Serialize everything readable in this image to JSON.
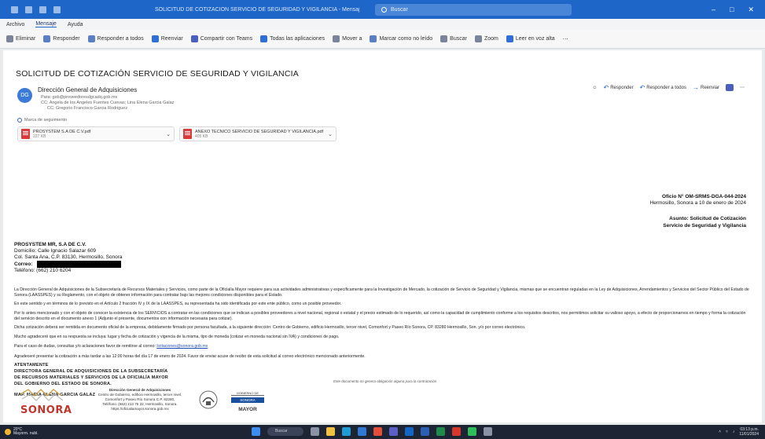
{
  "titlebar": {
    "title": "SOLICITUD DE COTIZACIÓN SERVICIO DE SEGURIDAD Y VIGILANCIA - Mensaje (HTML)",
    "search_placeholder": "Buscar"
  },
  "menu": {
    "tabs": [
      "Archivo",
      "Mensaje",
      "Ayuda"
    ]
  },
  "ribbon": {
    "items": [
      "Eliminar",
      "Responder",
      "Responder a todos",
      "Reenviar",
      "Compartir con Teams",
      "Todas las aplicaciones",
      "Mover a",
      "Marcar como no leído",
      "Buscar",
      "Zoom",
      "Leer en voz alta"
    ]
  },
  "message": {
    "subject": "SOLICITUD DE COTIZACIÓN SERVICIO DE SEGURIDAD Y VIGILANCIA",
    "sender": "Dirección General de Adquisiciones",
    "avatar_initials": "DG",
    "header_lines": [
      "Para: gsb@proveedoresdgcadq.gob.mx",
      "CC: Angela de los Angeles Fuentes Cuevas; Lina Elena Garcia Galaz",
      "CC: Gregorio Francisco Garcia Rodriguez"
    ],
    "flag_text": "Marca de seguimiento",
    "actions": [
      "Responder",
      "Responder a todos",
      "Reenviar"
    ],
    "attachments": [
      {
        "name": "PROSYSTEM S.A DE C.V.pdf",
        "size": "227 KB"
      },
      {
        "name": "ANEXO TECNICO SERVICIO DE SEGURIDAD Y VIGILANCIA.pdf",
        "size": "405 KB"
      }
    ]
  },
  "document": {
    "oficio": "Oficio N° OM-SRMS-DGA-044-2024",
    "place_date": "Hermosillo, Sonora a 10 de enero de 2024",
    "asunto_label": "Asunto: Solicitud de Cotización",
    "asunto_value": "Servicio de Seguridad y Vigilancia",
    "company": "PROSYSTEM MR, S.A DE C.V.",
    "domicilio": "Domicilio: Calle Ignacio Salazar 609",
    "colonia": "Col. Santa Ana, C.P. 83130, Hermosillo, Sonora",
    "correo_label": "Correo:",
    "telefono": "Teléfono: (662) 210 6204",
    "paragraphs": [
      "La Dirección General de Adquisiciones de la Subsecretaría de Recursos Materiales y Servicios, como parte de la Oficialía Mayor requiere para sus actividades administrativas y específicamente para la Investigación de Mercado, la cotización de Servicio de Seguridad y Vigilancia, mismas que se encuentran reguladas en la Ley de Adquisiciones, Arrendamientos y Servicios del Sector Público del Estado de Sonora (LAASSPES) y su Reglamento, con el objeto de obtener información para contratar bajo las mejores condiciones disponibles para el Estado.",
      "En este sentido y en términos de lo previsto en el Artículo 2 fracción IV y IX de la LAASSPES, su representada ha sido identificada por este ente público, como un posible proveedor.",
      "Por lo antes mencionado y con el objeto de conocer la existencia de los SERVICIOS a contratar en las condiciones que se indican a posibles proveedores a nivel nacional, regional o estatal y el precio estimado de lo requerido, así como la capacidad de cumplimiento conforme a los requisitos descritos, nos permitimos solicitar su valioso apoyo, a efecto de proporcionarnos en tiempo y forma la cotización del servicio descrito en el documento anexo 1 (Adjunto el presente, documentos con información necesaria para cotizar).",
      "Dicha cotización deberá ser remitida en documento oficial de la empresa, debidamente firmado por persona facultada, a la siguiente dirección: Centro de Gobierno, edificio Hermosillo, tercer nivel, Comonfort y Paseo Río Sonora, CP. 83280 Hermosillo, Son. y/o por correo electrónico.",
      "Mucho agradeceré que en su respuesta se incluya: lugar y fecha de cotización y vigencia de la misma, tipo de moneda (cotizar en moneda nacional sin IVA) y condiciones de pago.",
      "Para el caso de dudas, consultas y/o aclaraciones favor de remitirse al correo:",
      "Agradeceré presentar la cotización a más tardar a las 12:00 horas del día 17 de enero de 2024. Favor de enviar acuse de recibo de esta solicitud al correo electrónico mencionado anteriormente."
    ],
    "contact_email": "licitaciones@sonora.gob.mx",
    "sign_lines": [
      "ATENTAMENTE",
      "DIRECTORA GENERAL DE ADQUISICIONES DE LA SUBSECRETARÍA",
      "DE RECURSOS MATERIALES Y SERVICIOS DE LA OFICIALÍA MAYOR",
      "DEL GOBIERNO DEL ESTADO DE SONORA."
    ],
    "signer": "MAP. MARIA ELENA GARCIA GALAZ",
    "disclaimer": "Este documento no genera obligación alguna para la contratación",
    "footer_logo_text": "SONORA",
    "footer_lines": [
      "Dirección General de Adquisiciones",
      "Centro de Gobierno, edificio Hermosillo, tercer nivel,",
      "Comonfort y Paseo Río Sonora C.P. 83280,",
      "Teléfono: (662) 213 75 22, Hermosillo, Sonora.",
      "https://oficialiamayor.sonora.gob.mx"
    ],
    "mayor_top": "GOBIERNO DE",
    "mayor_badge": "SONORA",
    "mayor_word": "MAYOR"
  },
  "taskbar": {
    "weather_temp": "20°C",
    "weather_desc": "Mayorm. nubl.",
    "search": "Buscar",
    "time": "03:13 p.m.",
    "date": "11/01/2024"
  }
}
